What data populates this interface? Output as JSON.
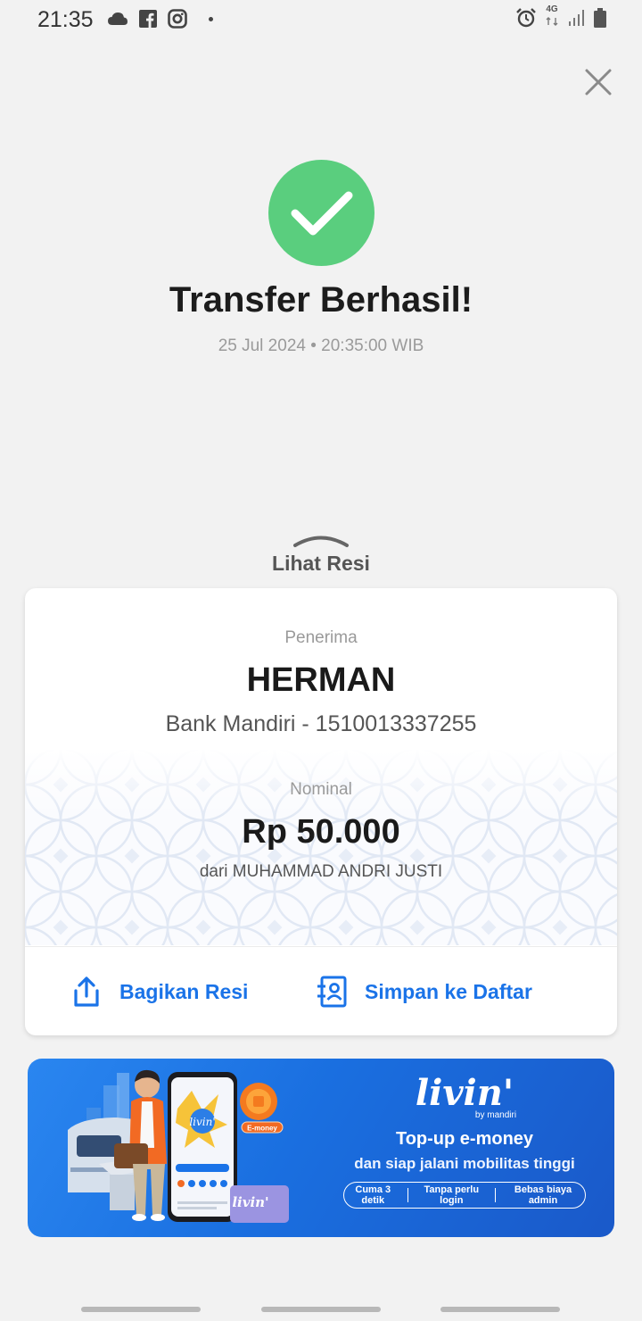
{
  "status_bar": {
    "time": "21:35",
    "left_icons": [
      "cloud-icon",
      "facebook-icon",
      "instagram-icon",
      "dot-icon"
    ],
    "right_icons": [
      "alarm-icon",
      "4g-icon",
      "signal-icon",
      "battery-icon"
    ],
    "network_label": "4G"
  },
  "close_icon": "close-icon",
  "success": {
    "icon": "check-icon",
    "color": "#5ace7e",
    "title": "Transfer Berhasil!",
    "datetime": "25 Jul 2024 • 20:35:00 WIB"
  },
  "receipt_toggle": {
    "label": "Lihat Resi",
    "icon": "chevron-up-icon"
  },
  "receipt": {
    "recipient_label": "Penerima",
    "recipient_name": "HERMAN",
    "recipient_account": "Bank Mandiri - 1510013337255",
    "amount_label": "Nominal",
    "amount": "Rp 50.000",
    "sender": "dari MUHAMMAD ANDRI JUSTI"
  },
  "actions": {
    "share_label": "Bagikan Resi",
    "share_icon": "share-icon",
    "save_label": "Simpan ke Daftar",
    "save_icon": "add-contact-icon",
    "accent_color": "#1a73e8"
  },
  "banner": {
    "brand": "livin'",
    "brand_sub": "by mandiri",
    "headline": "Top-up e-money",
    "subline": "dan siap jalani mobilitas tinggi",
    "features": [
      "Cuma 3 detik",
      "Tanpa perlu login",
      "Bebas biaya admin"
    ],
    "card_badge": "E-money",
    "phone_brand": "livin'",
    "card_brand": "livin'"
  }
}
